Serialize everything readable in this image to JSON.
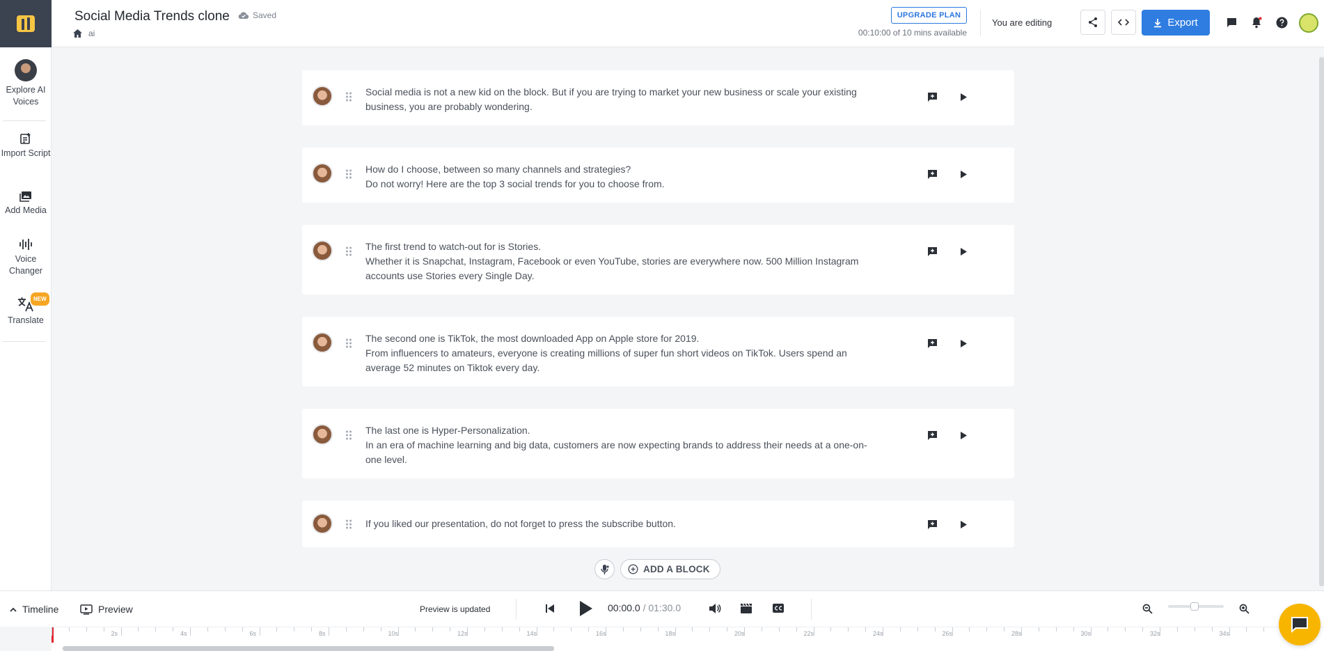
{
  "header": {
    "title": "Social Media Trends clone",
    "saved": "Saved",
    "breadcrumb": "ai",
    "upgrade": "UPGRADE PLAN",
    "availability": "00:10:00 of 10 mins available",
    "editing": "You are editing",
    "export": "Export"
  },
  "sidebar": {
    "items": [
      {
        "label": "Explore AI Voices"
      },
      {
        "label": "Import Script"
      },
      {
        "label": "Add Media"
      },
      {
        "label": "Voice Changer"
      },
      {
        "label": "Translate",
        "badge": "NEW"
      }
    ]
  },
  "blocks": [
    {
      "line1": "Social media is not a new kid on the block. But if you are trying to market your new business or scale your existing",
      "line2": "business, you are probably wondering.",
      "line3": ""
    },
    {
      "line1": "How do I choose, between so many channels and strategies?",
      "line2": "Do not worry! Here are the top 3 social trends for you to choose from.",
      "line3": ""
    },
    {
      "line1": "The first trend to watch-out for is Stories.",
      "line2": "Whether it is Snapchat, Instagram, Facebook or even YouTube, stories are everywhere now. 500 Million Instagram",
      "line3": "accounts use Stories every Single Day."
    },
    {
      "line1": "The second one is TikTok, the most downloaded App on Apple store for 2019.",
      "line2": "From influencers to amateurs, everyone is creating millions of super fun short videos on TikTok. Users spend an",
      "line3": "average 52 minutes on Tiktok every day."
    },
    {
      "line1": "The last one is Hyper-Personalization.",
      "line2": "In an era of machine learning and big data, customers are now expecting brands to address their needs at a one-on-",
      "line3": "one level."
    },
    {
      "line1": "If you liked our presentation, do not forget to press the subscribe button.",
      "line2": "",
      "line3": ""
    }
  ],
  "add_block": "ADD A BLOCK",
  "bottom": {
    "timeline": "Timeline",
    "preview": "Preview",
    "status": "Preview is updated",
    "current_time": "00:00.0",
    "total_time": "/ 01:30.0"
  },
  "ruler": {
    "labels": [
      "2s",
      "4s",
      "6s",
      "8s",
      "10s",
      "12s",
      "14s",
      "16s",
      "18s",
      "20s",
      "22s",
      "24s",
      "26s",
      "28s",
      "30s",
      "32s",
      "34s"
    ]
  }
}
